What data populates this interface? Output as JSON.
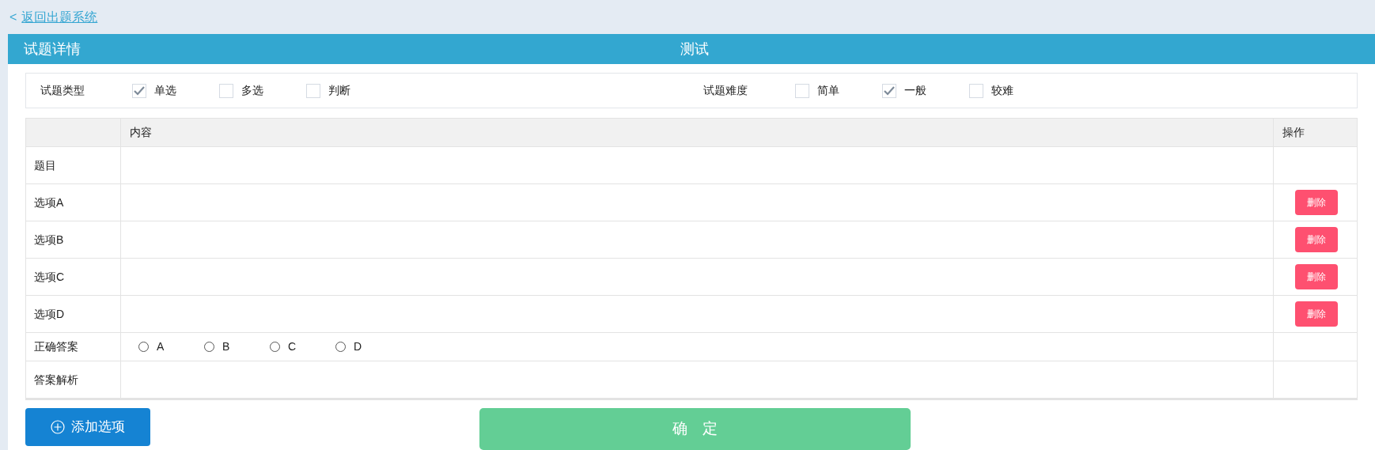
{
  "back_link": {
    "arrow": "<",
    "label": "返回出题系统"
  },
  "header": {
    "title": "试题详情",
    "subtitle": "测试"
  },
  "filters": [
    {
      "label": "试题类型",
      "options": [
        {
          "label": "单选",
          "checked": true
        },
        {
          "label": "多选",
          "checked": false
        },
        {
          "label": "判断",
          "checked": false
        }
      ]
    },
    {
      "label": "试题难度",
      "options": [
        {
          "label": "简单",
          "checked": false
        },
        {
          "label": "一般",
          "checked": true
        },
        {
          "label": "较难",
          "checked": false
        }
      ]
    }
  ],
  "table": {
    "columns": [
      "内容",
      "操作"
    ],
    "rows": [
      {
        "kind": "text",
        "label": "题目"
      },
      {
        "kind": "option",
        "label": "选项A",
        "action": "删除"
      },
      {
        "kind": "option",
        "label": "选项B",
        "action": "删除"
      },
      {
        "kind": "option",
        "label": "选项C",
        "action": "删除"
      },
      {
        "kind": "option",
        "label": "选项D",
        "action": "删除"
      },
      {
        "kind": "answer",
        "label": "正确答案",
        "choices": [
          {
            "label": "A",
            "selected": false
          },
          {
            "label": "B",
            "selected": false
          },
          {
            "label": "C",
            "selected": false
          },
          {
            "label": "D",
            "selected": false
          }
        ]
      },
      {
        "kind": "text",
        "label": "答案解析"
      }
    ]
  },
  "buttons": {
    "add": "添加选项",
    "confirm": "确　定"
  }
}
